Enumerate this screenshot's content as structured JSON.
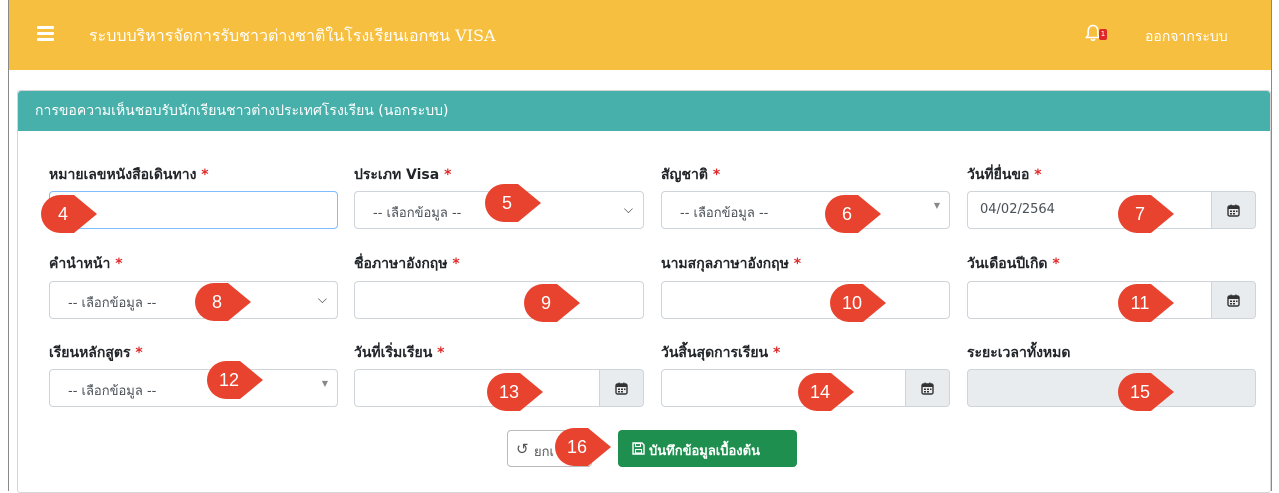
{
  "app": {
    "title": "ระบบบริหารจัดการรับชาวต่างชาติในโรงเรียนเอกชน VISA",
    "notification_count": "1",
    "logout_label": "ออกจากระบบ"
  },
  "colors": {
    "navbar": "#f7bf3f",
    "card_header": "#48b0ab",
    "marker": "#e8432e",
    "save_button": "#1e8f4e",
    "required": "#e02828"
  },
  "form": {
    "header": "การขอความเห็นชอบรับนักเรียนชาวต่างประเทศโรงเรียน (นอกระบบ)",
    "required_mark": "*",
    "fields": {
      "passport": {
        "label": "หมายเลขหนังสือเดินทาง",
        "value": "",
        "marker": "4"
      },
      "visa_type": {
        "label": "ประเภท Visa",
        "value": "-- เลือกข้อมูล --",
        "marker": "5"
      },
      "nationality": {
        "label": "สัญชาติ",
        "value": "-- เลือกข้อมูล --",
        "marker": "6"
      },
      "request_date": {
        "label": "วันที่ยื่นขอ",
        "value": "04/02/2564",
        "marker": "7"
      },
      "prefix": {
        "label": "คำนำหน้า",
        "value": "-- เลือกข้อมูล --",
        "marker": "8"
      },
      "first_name_en": {
        "label": "ชื่อภาษาอังกฤษ",
        "value": "",
        "marker": "9"
      },
      "last_name_en": {
        "label": "นามสกุลภาษาอังกฤษ",
        "value": "",
        "marker": "10"
      },
      "birth_date": {
        "label": "วันเดือนปีเกิด",
        "value": "",
        "marker": "11"
      },
      "course": {
        "label": "เรียนหลักสูตร",
        "value": "-- เลือกข้อมูล --",
        "marker": "12"
      },
      "start_date": {
        "label": "วันที่เริ่มเรียน",
        "value": "",
        "marker": "13"
      },
      "end_date": {
        "label": "วันสิ้นสุดการเรียน",
        "value": "",
        "marker": "14"
      },
      "total_duration": {
        "label": "ระยะเวลาทั้งหมด",
        "value": "",
        "marker": "15"
      }
    },
    "buttons": {
      "reset_label": "ยกเ",
      "save_label": "บันทึกข้อมูลเบื้องต้น",
      "marker": "16"
    }
  },
  "icons": {
    "menu": "hamburger-icon",
    "notification": "bell-icon",
    "calendar": "calendar-icon",
    "reset": "undo-icon",
    "save": "floppy-disk-icon",
    "select": "chevron-down-icon"
  }
}
